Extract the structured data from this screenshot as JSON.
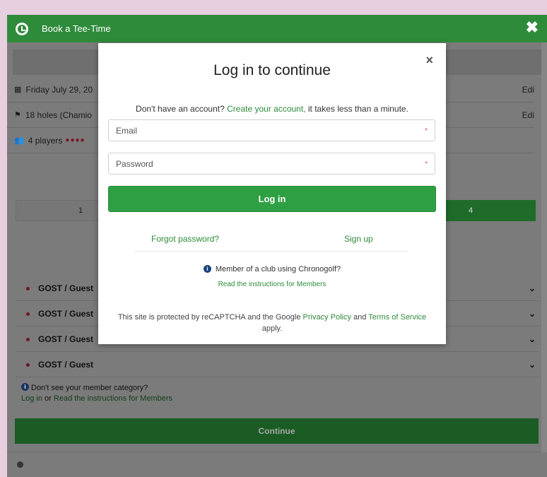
{
  "header": {
    "title": "Book a Tee-Time",
    "close_glyph": "✖"
  },
  "background": {
    "date_row": {
      "icon": "calendar-icon",
      "text": "Friday July 29, 20",
      "edit": "Edi"
    },
    "holes_row": {
      "icon": "golf-flag-icon",
      "text": "18 holes (Chamio",
      "edit": "Edi"
    },
    "players_row": {
      "icon": "users-icon",
      "text": "4 players",
      "dots": "●●●●"
    },
    "player_tabs": [
      "1",
      "",
      "",
      "4"
    ],
    "guest_rows": [
      "GOST / Guest",
      "GOST / Guest",
      "GOST / Guest",
      "GOST / Guest"
    ],
    "member_note": {
      "line1": "Don't see your member category?",
      "login": "Log in",
      "or": "or",
      "link": "Read the instructions for Members"
    },
    "continue_label": "Continue"
  },
  "modal": {
    "close_glyph": "×",
    "title": "Log in to continue",
    "signup_prefix": "Don't have an account?",
    "signup_link": "Create your account,",
    "signup_suffix": "it takes less than a minute.",
    "email_placeholder": "Email",
    "password_placeholder": "Password",
    "required_mark": "*",
    "login_label": "Log in",
    "forgot_label": "Forgot password?",
    "signup_label": "Sign up",
    "member_question": "Member of a club using Chronogolf?",
    "member_link": "Read the instructions for Members",
    "recaptcha_prefix": "This site is protected by reCAPTCHA and the Google",
    "privacy_link": "Privacy Policy",
    "and": "and",
    "terms_link": "Terms of Service",
    "recaptcha_suffix": "apply."
  },
  "colors": {
    "accent": "#2e8b3a",
    "button": "#2ea043",
    "overlay": "#7b7b7b",
    "dot_red": "#7a1420"
  }
}
